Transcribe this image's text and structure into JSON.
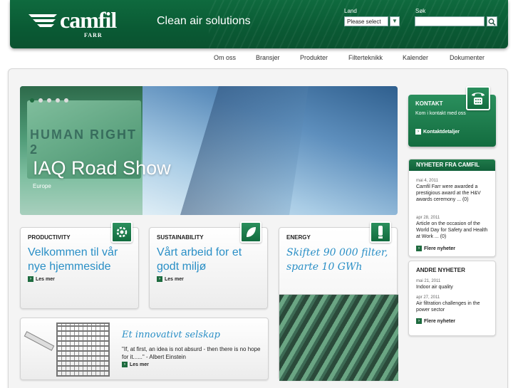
{
  "header": {
    "logo_text": "camfil",
    "logo_sub": "FARR",
    "tagline": "Clean air solutions",
    "country_label": "Land",
    "country_select_value": "Please select",
    "search_label": "Søk"
  },
  "nav": {
    "items": [
      "Om oss",
      "Bransjer",
      "Produkter",
      "Filterteknikk",
      "Kalender",
      "Dokumenter"
    ]
  },
  "hero": {
    "title": "IAQ Road Show",
    "subtitle": "Europe",
    "truck_text": "HUMAN RIGHT 2"
  },
  "cards": [
    {
      "head": "PRODUCTIVITY",
      "title": "Velkommen til vår nye hjemmeside",
      "more": "Les mer"
    },
    {
      "head": "SUSTAINABILITY",
      "title": "Vårt arbeid for et godt miljø",
      "more": "Les mer"
    },
    {
      "head": "ENERGY",
      "title": "Skiftet 90 000 filter, sparte 10 GWh"
    }
  ],
  "innovative": {
    "title": "Et innovativt selskap",
    "quote": "\"If, at first, an idea is not absurd - then there is no hope for it......\" - Albert Einstein",
    "more": "Les mer"
  },
  "contact": {
    "head": "KONTAKT",
    "text": "Kom i kontakt med oss",
    "link": "Kontaktdetaljer"
  },
  "news": {
    "head": "NYHETER FRA CAMFIL",
    "items": [
      {
        "date": "mai 4, 2011",
        "text": "Camfil Farr were awarded a prestigious award at the H&V awards ceremony ... (0)"
      },
      {
        "date": "apr 28, 2011",
        "text": "Article on the occasion of the World Day for Safety and Health at Work ... (0)"
      }
    ],
    "more": "Flere nyheter"
  },
  "other_news": {
    "head": "ANDRE NYHETER",
    "items": [
      {
        "date": "mai 21, 2011",
        "text": "Indoor air quality"
      },
      {
        "date": "apr 27, 2011",
        "text": "Air filtration challenges in the power sector"
      }
    ],
    "more": "Flere nyheter"
  },
  "colors": {
    "brand_green": "#136c3f",
    "link_blue": "#2a8fc6"
  }
}
